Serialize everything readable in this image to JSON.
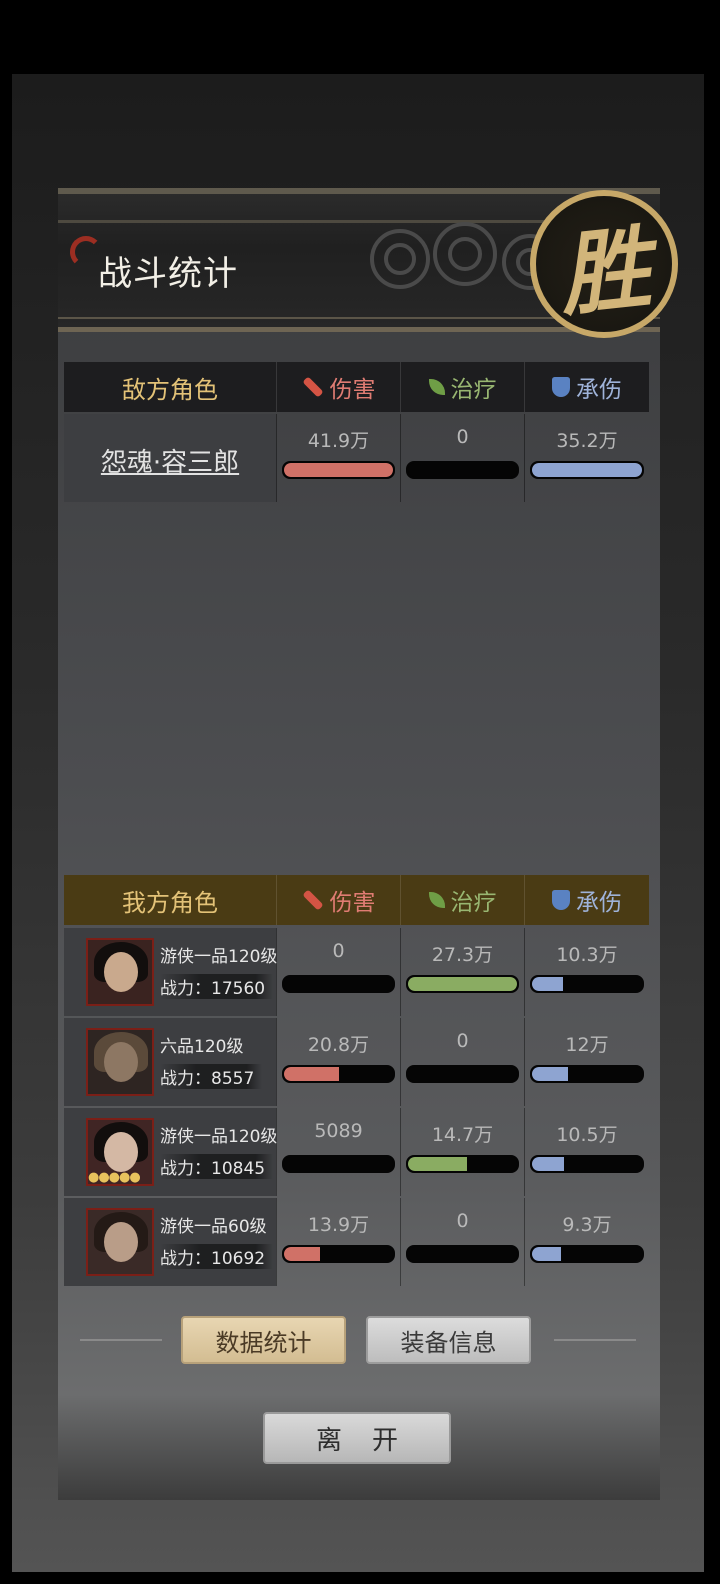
{
  "header": {
    "title": "战斗统计",
    "result_seal": "胜"
  },
  "columns": {
    "damage": "伤害",
    "heal": "治疗",
    "tanked": "承伤",
    "damage_icon": "sword-icon",
    "heal_icon": "leaf-icon",
    "tanked_icon": "shield-icon"
  },
  "enemy": {
    "section_label": "敌方角色",
    "rows": [
      {
        "name": "怨魂·容三郎",
        "damage": "41.9万",
        "damage_fill": 1.0,
        "heal": "0",
        "heal_fill": 0,
        "tanked": "35.2万",
        "tanked_fill": 1.0
      }
    ]
  },
  "ally": {
    "section_label": "我方角色",
    "power_label": "战力：",
    "rows": [
      {
        "rank": "游侠一品120级",
        "power": "17560",
        "damage": "0",
        "damage_fill": 0,
        "heal": "27.3万",
        "heal_fill": 1.0,
        "tanked": "10.3万",
        "tanked_fill": 0.28
      },
      {
        "rank": "六品120级",
        "power": "8557",
        "damage": "20.8万",
        "damage_fill": 0.5,
        "heal": "0",
        "heal_fill": 0,
        "tanked": "12万",
        "tanked_fill": 0.33
      },
      {
        "rank": "游侠一品120级",
        "power": "10845",
        "damage": "5089",
        "damage_fill": 0,
        "heal": "14.7万",
        "heal_fill": 0.54,
        "tanked": "10.5万",
        "tanked_fill": 0.29
      },
      {
        "rank": "游侠一品60级",
        "power": "10692",
        "damage": "13.9万",
        "damage_fill": 0.33,
        "heal": "0",
        "heal_fill": 0,
        "tanked": "9.3万",
        "tanked_fill": 0.26
      }
    ]
  },
  "buttons": {
    "stats": "数据统计",
    "equipment": "装备信息",
    "leave": "离开"
  },
  "colors": {
    "damage": "#d07167",
    "heal": "#8aac62",
    "tanked": "#8ea4d1",
    "gold": "#e3c277"
  }
}
